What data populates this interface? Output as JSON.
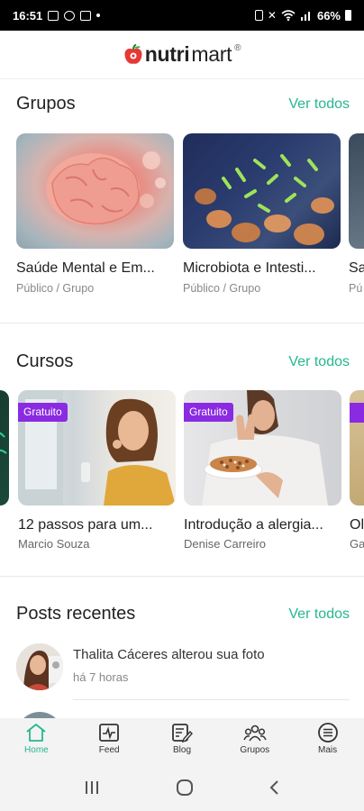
{
  "status": {
    "time": "16:51",
    "battery": "66%"
  },
  "brand": {
    "name_bold": "nutri",
    "name_regular": "mart",
    "registered": "®"
  },
  "sections": {
    "groups": {
      "title": "Grupos",
      "see_all": "Ver todos"
    },
    "courses": {
      "title": "Cursos",
      "see_all": "Ver todos"
    },
    "posts": {
      "title": "Posts recentes",
      "see_all": "Ver todos"
    }
  },
  "groups": [
    {
      "title": "Saúde Mental e Em...",
      "meta": "Público / Grupo"
    },
    {
      "title": "Microbiota e Intesti...",
      "meta": "Público / Grupo"
    },
    {
      "title": "Sa",
      "meta": "Pú"
    }
  ],
  "courses": [
    {
      "badge": "Gratuito",
      "title": "12 passos para um...",
      "author": "Marcio Souza"
    },
    {
      "badge": "Gratuito",
      "title": "Introdução a alergia...",
      "author": "Denise Carreiro"
    },
    {
      "badge": "",
      "title": "Ol",
      "author": "Ga"
    }
  ],
  "recent_post": {
    "text": "Thalita Cáceres alterou sua foto",
    "time": "há 7 horas"
  },
  "bottom_nav": [
    {
      "label": "Home",
      "icon": "home-icon",
      "active": true
    },
    {
      "label": "Feed",
      "icon": "feed-icon",
      "active": false
    },
    {
      "label": "Blog",
      "icon": "blog-icon",
      "active": false
    },
    {
      "label": "Grupos",
      "icon": "groups-icon",
      "active": false
    },
    {
      "label": "Mais",
      "icon": "menu-icon",
      "active": false
    }
  ],
  "colors": {
    "accent": "#25b78f",
    "badge": "#8a2be2",
    "logo_red": "#e53935"
  }
}
